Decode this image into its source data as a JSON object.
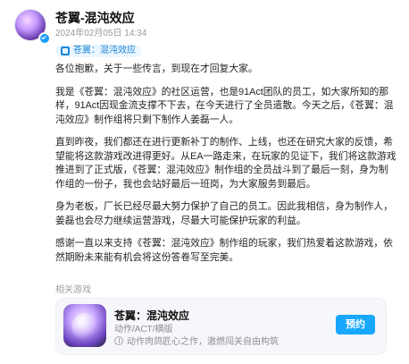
{
  "post": {
    "author_name": "苍翼-混沌效应",
    "time": "2024年02月05日 14:34",
    "tag": "苍翼：混沌效应",
    "paragraphs": [
      "各位抱歉，关于一些传言，到现在才回复大家。",
      "我是《苍翼：混沌效应》的社区运营，也是91Act团队的员工，如大家所知的那样，91Act因现金流支撑不下去，在今天进行了全员遣散。今天之后，《苍翼：混沌效应》制作组将只剩下制作人姜磊一人。",
      "直到昨夜，我们都还在进行更新补丁的制作、上线，也还在研究大家的反馈，希望能将这款游戏改进得更好。从EA一路走来，在玩家的见证下，我们将这款游戏推进到了正式版，《苍翼：混沌效应》制作组的全员战斗到了最后一刻，身为制作组的一份子，我也会站好最后一班岗，为大家服务到最后。",
      "身为老板，厂长已经尽最大努力保护了自己的员工。因此我相信，身为制作人，姜磊也会尽力继续运营游戏，尽最大可能保护玩家的利益。",
      "感谢一直以来支持《苍翼：混沌效应》制作组的玩家，我们热爱着这款游戏，依然期盼未来能有机会将这份答卷写至完美。"
    ],
    "related_label": "相关游戏"
  },
  "related_game": {
    "title": "苍翼：混沌效应",
    "genre": "动作/ACT/横版",
    "note": "动作肉鸽匠心之作，激燃闯关自由构筑",
    "button_label": "预约"
  },
  "icons": {
    "avatar": "avatar-image",
    "verified": "verified-badge-icon",
    "tag": "game-tag-icon",
    "info": "info-icon"
  },
  "colors": {
    "accent_blue": "#18a7ff",
    "tag_blue": "#1c86d8",
    "tag_bg": "#eaf6ff"
  }
}
